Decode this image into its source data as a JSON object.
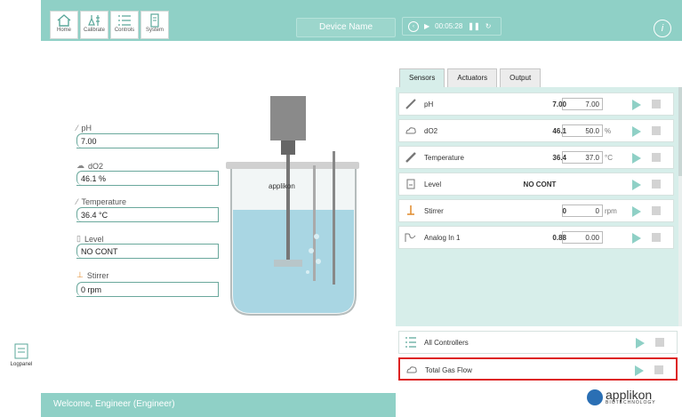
{
  "nav": {
    "home": "Home",
    "calibrate": "Calibrate",
    "controls": "Controls",
    "system": "System"
  },
  "header": {
    "device_name": "Device Name",
    "timer": "00:05:28",
    "info": "i"
  },
  "left_panel": {
    "ph_label": "pH",
    "ph_value": "7.00",
    "do2_label": "dO2",
    "do2_value": "46.1 %",
    "temp_label": "Temperature",
    "temp_value": "36.4 °C",
    "level_label": "Level",
    "level_value": "NO CONT",
    "stirrer_label": "Stirrer",
    "stirrer_value": "0 rpm",
    "logpanel": "Logpanel"
  },
  "tabs": [
    "Sensors",
    "Actuators",
    "Output"
  ],
  "sensors": [
    {
      "name": "pH",
      "value": "7.00",
      "setpoint": "7.00",
      "unit": "",
      "icon": "ph-icon"
    },
    {
      "name": "dO2",
      "value": "46.1",
      "setpoint": "50.0",
      "unit": "%",
      "icon": "cloud-icon"
    },
    {
      "name": "Temperature",
      "value": "36.4",
      "setpoint": "37.0",
      "unit": "°C",
      "icon": "thermometer-icon"
    },
    {
      "name": "Level",
      "value": "NO CONT",
      "setpoint": "",
      "unit": "",
      "icon": "level-icon"
    },
    {
      "name": "Stirrer",
      "value": "0",
      "setpoint": "0",
      "unit": "rpm",
      "icon": "stirrer-icon"
    },
    {
      "name": "Analog In 1",
      "value": "0.88",
      "setpoint": "0.00",
      "unit": "",
      "icon": "analog-icon"
    }
  ],
  "bottom": {
    "all_controllers": "All Controllers",
    "total_gas_flow": "Total Gas Flow"
  },
  "footer": {
    "welcome": "Welcome, Engineer (Engineer)"
  },
  "brand": {
    "logo": "applikon",
    "logo_sub": "BIOTECHNOLOGY",
    "vessel_logo": "applikon"
  },
  "colors": {
    "teal": "#8fd0c6",
    "panel": "#d7eeea",
    "highlight": "#dd2222"
  }
}
